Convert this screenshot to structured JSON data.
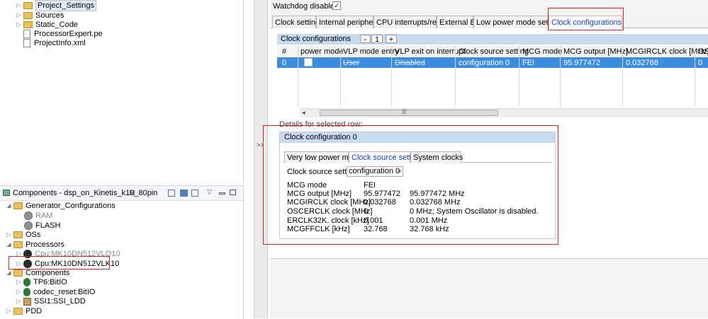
{
  "left_top": {
    "items": [
      {
        "label": "Project_Settings",
        "icon": "folder-icon"
      },
      {
        "label": "Sources",
        "icon": "folder-icon"
      },
      {
        "label": "Static_Code",
        "icon": "folder-icon"
      },
      {
        "label": "ProcessorExpert.pe",
        "icon": "file-icon"
      },
      {
        "label": "ProjectInfo.xml",
        "icon": "file-icon"
      }
    ]
  },
  "components_panel": {
    "title": "Components - dsp_on_Kinetis_k10_80pin",
    "close_glyph": "⊠",
    "items": [
      {
        "label": "Generator_Configurations",
        "icon": "folder-icon"
      },
      {
        "label": "RAM",
        "icon": "gear-icon"
      },
      {
        "label": "FLASH",
        "icon": "gear-icon"
      },
      {
        "label": "OSs",
        "icon": "folder-icon"
      },
      {
        "label": "Processors",
        "icon": "folder-icon"
      },
      {
        "label": "Cpu:MK10DN512VLQ10",
        "icon": "cpu-icon"
      },
      {
        "label": "Cpu:MK10DN512VLK10",
        "icon": "cpu-icon"
      },
      {
        "label": "Components",
        "icon": "folder-icon"
      },
      {
        "label": "TP6:BitIO",
        "icon": "bean-icon"
      },
      {
        "label": "codec_reset:BitIO",
        "icon": "bean-icon"
      },
      {
        "label": "SSI1:SSI_LDD",
        "icon": "component-icon"
      },
      {
        "label": "PDD",
        "icon": "folder-icon"
      }
    ]
  },
  "splitter": {
    "label": ">>"
  },
  "watchdog": {
    "label": "Watchdog disable",
    "checked": true,
    "check_glyph": "✓"
  },
  "tabs": [
    "Clock settings",
    "Internal peripherals",
    "CPU interrupts/resets",
    "External Bus",
    "Low power mode settings",
    "Clock configurations"
  ],
  "clock_configs": {
    "title": "Clock configurations",
    "minus": "-",
    "count": "1",
    "plus": "+",
    "columns": [
      "#",
      "power mode",
      "VLP mode entry",
      "VLP exit on interrupt",
      "Clock source setting",
      "MCG mode",
      "MCG output [MHz]",
      "MCGIRCLK clock [MHz]",
      "OSC"
    ],
    "row": [
      "0",
      "",
      "User",
      "Disabled",
      "configuration 0",
      "FEI",
      "95.977472",
      "0.032768",
      "0"
    ],
    "scroll_left": "◂",
    "scroll_grip": "|||"
  },
  "details": {
    "label": "Details for selected row:",
    "group_title": "Clock configuration 0",
    "inner_tabs": [
      "Very low power mode",
      "Clock source setting",
      "System clocks"
    ],
    "source_setting_label": "Clock source setting",
    "source_setting_value": "configuration 0",
    "dropdown_glyph": "▾",
    "rows": [
      {
        "name": "MCG mode",
        "value": "FEI",
        "desc": ""
      },
      {
        "name": "MCG output [MHz]",
        "value": "95.977472",
        "desc": "95.977472 MHz"
      },
      {
        "name": "MCGIRCLK clock [MHz]",
        "value": "0.032768",
        "desc": "0.032768 MHz"
      },
      {
        "name": "OSCERCLK clock [MHz]",
        "value": "0",
        "desc": "0 MHz; System Oscillator is disabled."
      },
      {
        "name": "ERCLK32K. clock [kHz]",
        "value": "0.001",
        "desc": "0.001 MHz"
      },
      {
        "name": "MCGFFCLK [kHz]",
        "value": "32.768",
        "desc": "32.768 kHz"
      }
    ]
  },
  "colors": {
    "selection": "#3c8ce0",
    "header_band": "#c8daf0",
    "highlight": "#e02020"
  }
}
